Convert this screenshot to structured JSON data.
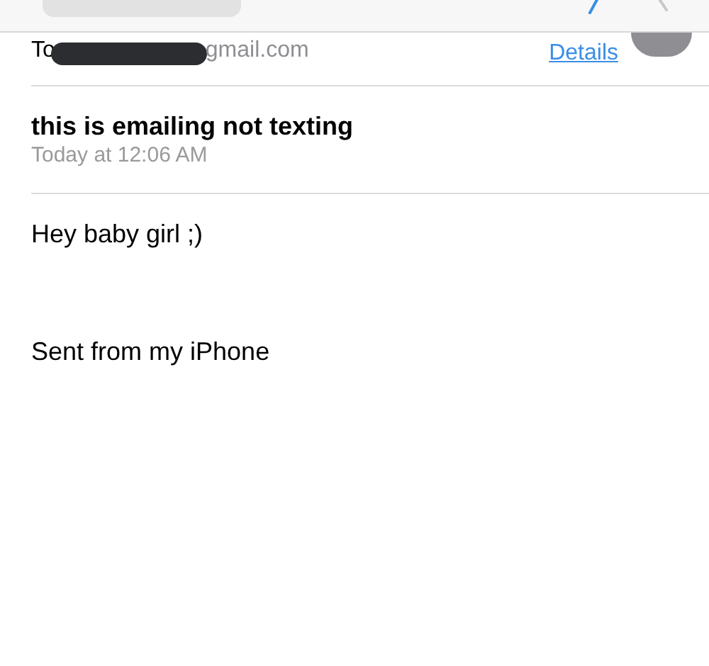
{
  "header": {
    "to_label": "To",
    "recipient_visible": "gmail.com",
    "details_link": "Details"
  },
  "message": {
    "subject": "this is emailing not texting",
    "date": "Today at 12:06 AM"
  },
  "body": [
    "Hey baby girl ;)",
    "Sent from my iPhone"
  ]
}
